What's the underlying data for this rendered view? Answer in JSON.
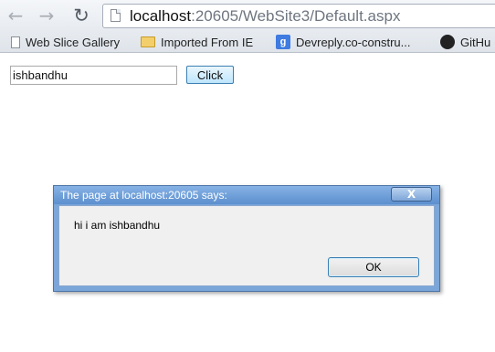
{
  "browser": {
    "address_host": "localhost",
    "address_rest": ":20605/WebSite3/Default.aspx",
    "bookmarks": [
      {
        "label": "Web Slice Gallery",
        "icon": "document-icon"
      },
      {
        "label": "Imported From IE",
        "icon": "folder-icon"
      },
      {
        "label": "Devreply.co-constru...",
        "icon": "google-icon",
        "icon_text": "g"
      },
      {
        "label": "GitHu",
        "icon": "github-icon"
      }
    ]
  },
  "page": {
    "input_value": "ishbandhu",
    "button_label": "Click"
  },
  "dialog": {
    "title": "The page at localhost:20605 says:",
    "message": "hi i am ishbandhu",
    "ok_label": "OK",
    "close_label": "X"
  }
}
